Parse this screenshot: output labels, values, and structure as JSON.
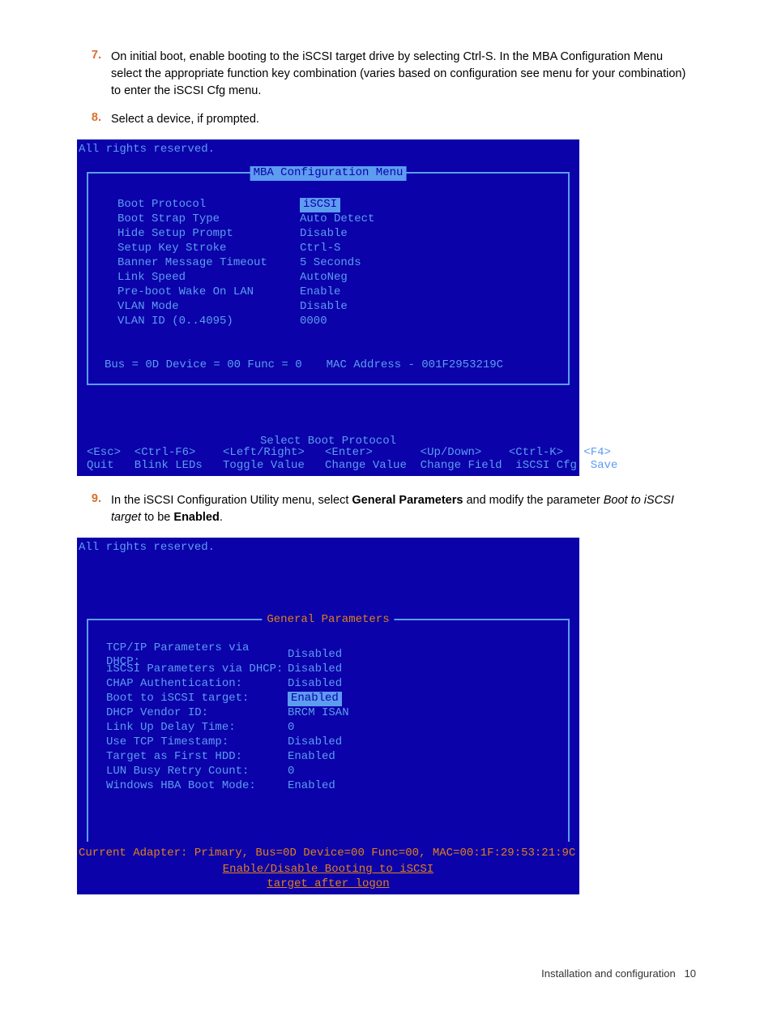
{
  "steps": {
    "s7": {
      "num": "7.",
      "text_a": "On initial boot, enable booting to the iSCSI target drive by selecting Ctrl-S. In the MBA Configuration Menu select the appropriate function key combination (varies based on configuration see menu for your combination) to enter the iSCSI Cfg menu."
    },
    "s8": {
      "num": "8.",
      "text_a": "Select a device, if prompted."
    },
    "s9": {
      "num": "9.",
      "text_a": "In the iSCSI Configuration Utility menu, select ",
      "bold1": "General Parameters",
      "text_b": " and modify the parameter ",
      "italic1": "Boot to iSCSI target",
      "text_c": " to be ",
      "bold2": "Enabled",
      "text_d": "."
    }
  },
  "bios1": {
    "rights": "All rights reserved.",
    "title": "MBA Configuration Menu",
    "rows": [
      {
        "label": "Boot Protocol",
        "value": "iSCSI",
        "sel": true
      },
      {
        "label": "Boot Strap Type",
        "value": "Auto Detect",
        "sel": false
      },
      {
        "label": "Hide Setup Prompt",
        "value": "Disable",
        "sel": false
      },
      {
        "label": "Setup Key Stroke",
        "value": "Ctrl-S",
        "sel": false
      },
      {
        "label": "Banner Message Timeout",
        "value": "5 Seconds",
        "sel": false
      },
      {
        "label": "Link Speed",
        "value": "AutoNeg",
        "sel": false
      },
      {
        "label": "Pre-boot Wake On LAN",
        "value": "Enable",
        "sel": false
      },
      {
        "label": "VLAN Mode",
        "value": "Disable",
        "sel": false
      },
      {
        "label": "VLAN ID (0..4095)",
        "value": "0000",
        "sel": false
      }
    ],
    "busline_a": "Bus = 0D Device = 00 Func = 0",
    "busline_b": "MAC Address - 001F2953219C",
    "select_msg": "Select Boot Protocol",
    "fkeys1": "<Esc>  <Ctrl-F6>    <Left/Right>   <Enter>       <Up/Down>    <Ctrl-K>   <F4>",
    "fkeys2": "Quit   Blink LEDs   Toggle Value   Change Value  Change Field  iSCSI Cfg  Save"
  },
  "bios2": {
    "rights": "All rights reserved.",
    "title": "General Parameters",
    "rows": [
      {
        "label": "TCP/IP Parameters via DHCP:",
        "value": "Disabled",
        "sel": false
      },
      {
        "label": "iSCSI Parameters via DHCP:",
        "value": "Disabled",
        "sel": false
      },
      {
        "label": "CHAP Authentication:",
        "value": "Disabled",
        "sel": false
      },
      {
        "label": "Boot to iSCSI target:",
        "value": "Enabled",
        "sel": true
      },
      {
        "label": "DHCP Vendor ID:",
        "value": "BRCM ISAN",
        "sel": false
      },
      {
        "label": "Link Up Delay Time:",
        "value": "0",
        "sel": false
      },
      {
        "label": "Use TCP Timestamp:",
        "value": "Disabled",
        "sel": false
      },
      {
        "label": "Target as First HDD:",
        "value": "Enabled",
        "sel": false
      },
      {
        "label": "LUN Busy Retry Count:",
        "value": "0",
        "sel": false
      },
      {
        "label": "Windows HBA Boot Mode:",
        "value": "Enabled",
        "sel": false
      }
    ],
    "cur_adapter": "Current Adapter: Primary, Bus=0D Device=00 Func=00, MAC=00:1F:29:53:21:9C",
    "help": "Enable/Disable Booting to iSCSI target after logon"
  },
  "footer": {
    "section": "Installation and configuration",
    "page": "10"
  }
}
